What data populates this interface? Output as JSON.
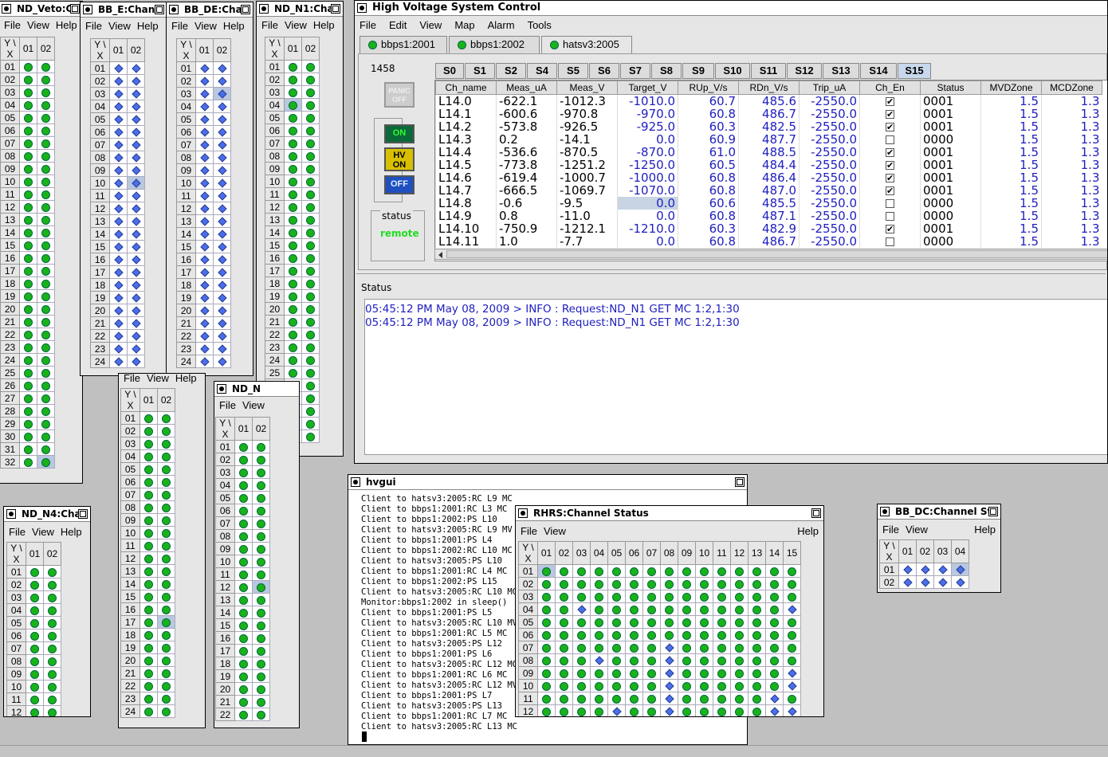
{
  "menus": {
    "file": "File",
    "view": "View",
    "help": "Help",
    "edit": "Edit",
    "map": "Map",
    "alarm": "Alarm",
    "tools": "Tools"
  },
  "grid_header": "Y \\ X",
  "windows": {
    "nd_veto": {
      "title": "ND_Veto:Cl"
    },
    "bb_e": {
      "title": "BB_E:Chan"
    },
    "bb_de": {
      "title": "BB_DE:Cha"
    },
    "nd_n1": {
      "title": "ND_N1:Cha"
    },
    "nd_n4": {
      "title": "ND_N4:Cha"
    },
    "nd_n": {
      "title": "ND_N"
    },
    "bb_dc": {
      "title": "BB_DC:Channel St"
    },
    "hvgui": {
      "title": "hvgui"
    },
    "rhrs": {
      "title": "RHRS:Channel Status"
    },
    "hv": {
      "title": "High Voltage System Control"
    }
  },
  "hv": {
    "tabs": [
      "bbps1:2001",
      "bbps1:2002",
      "hatsv3:2005"
    ],
    "active_tab": "hatsv3:2005",
    "panel_id": "1458",
    "panic_label": "PANIC OFF",
    "on_label": "ON",
    "hv_on_label": "HV ON",
    "off_label": "OFF",
    "status_label": "status",
    "status_value": "remote",
    "subtabs": [
      "S0",
      "S1",
      "S2",
      "S4",
      "S5",
      "S6",
      "S7",
      "S8",
      "S9",
      "S10",
      "S11",
      "S12",
      "S13",
      "S14",
      "S15"
    ],
    "active_subtab": "S15",
    "columns": [
      "Ch_name",
      "Meas_uA",
      "Meas_V",
      "Target_V",
      "RUp_V/s",
      "RDn_V/s",
      "Trip_uA",
      "Ch_En",
      "Status",
      "MVDZone",
      "MCDZone"
    ],
    "rows": [
      [
        "L14.0",
        "-622.1",
        "-1012.3",
        "-1010.0",
        "60.7",
        "485.6",
        "-2550.0",
        true,
        "0001",
        "1.5",
        "1.3"
      ],
      [
        "L14.1",
        "-600.6",
        "-970.8",
        "-970.0",
        "60.8",
        "486.7",
        "-2550.0",
        true,
        "0001",
        "1.5",
        "1.3"
      ],
      [
        "L14.2",
        "-573.8",
        "-926.5",
        "-925.0",
        "60.3",
        "482.5",
        "-2550.0",
        true,
        "0001",
        "1.5",
        "1.3"
      ],
      [
        "L14.3",
        "0.2",
        "-14.1",
        "0.0",
        "60.9",
        "487.7",
        "-2550.0",
        false,
        "0000",
        "1.5",
        "1.3"
      ],
      [
        "L14.4",
        "-536.6",
        "-870.5",
        "-870.0",
        "61.0",
        "488.5",
        "-2550.0",
        true,
        "0001",
        "1.5",
        "1.3"
      ],
      [
        "L14.5",
        "-773.8",
        "-1251.2",
        "-1250.0",
        "60.5",
        "484.4",
        "-2550.0",
        true,
        "0001",
        "1.5",
        "1.3"
      ],
      [
        "L14.6",
        "-619.4",
        "-1000.7",
        "-1000.0",
        "60.8",
        "486.4",
        "-2550.0",
        true,
        "0001",
        "1.5",
        "1.3"
      ],
      [
        "L14.7",
        "-666.5",
        "-1069.7",
        "-1070.0",
        "60.8",
        "487.0",
        "-2550.0",
        true,
        "0001",
        "1.5",
        "1.3"
      ],
      [
        "L14.8",
        "-0.6",
        "-9.5",
        "0.0",
        "60.6",
        "485.5",
        "-2550.0",
        false,
        "0000",
        "1.5",
        "1.3"
      ],
      [
        "L14.9",
        "0.8",
        "-11.0",
        "0.0",
        "60.8",
        "487.1",
        "-2550.0",
        false,
        "0000",
        "1.5",
        "1.3"
      ],
      [
        "L14.10",
        "-750.9",
        "-1212.1",
        "-1210.0",
        "60.3",
        "482.9",
        "-2550.0",
        true,
        "0001",
        "1.5",
        "1.3"
      ],
      [
        "L14.11",
        "1.0",
        "-7.7",
        "0.0",
        "60.8",
        "486.7",
        "-2550.0",
        false,
        "0000",
        "1.5",
        "1.3"
      ]
    ],
    "status_title": "Status",
    "log": [
      "05:45:12 PM May 08, 2009 > INFO : Request:ND_N1 GET MC 1:2,1:30",
      "05:45:12 PM May 08, 2009 > INFO : Request:ND_N1 GET MC 1:2,1:30"
    ]
  },
  "hvgui_log": [
    "Client to hatsv3:2005:RC L9 MC",
    "Client to bbps1:2001:RC L3 MC",
    "Client to bbps1:2002:PS L10",
    "Client to hatsv3:2005:RC L9 MV",
    "Client to bbps1:2001:PS L4",
    "Client to bbps1:2002:RC L10 MC",
    "Client to hatsv3:2005:PS L10",
    "Client to bbps1:2001:RC L4 MC",
    "Client to bbps1:2002:PS L15",
    "Client to hatsv3:2005:RC L10 MC",
    "Monitor:bbps1:2002 in sleep()",
    "Client to bbps1:2001:PS L5",
    "Client to hatsv3:2005:RC L10 MV",
    "Client to bbps1:2001:RC L5 MC",
    "Client to hatsv3:2005:PS L12",
    "Client to bbps1:2001:PS L6",
    "Client to hatsv3:2005:RC L12 MC",
    "Client to bbps1:2001:RC L6 MC",
    "Client to hatsv3:2005:RC L12 MV",
    "Client to bbps1:2001:PS L7",
    "Client to hatsv3:2005:PS L13",
    "Client to bbps1:2001:RC L7 MC",
    "Client to hatsv3:2005:RC L13 MC"
  ],
  "colors": {
    "led_green": "#19b319",
    "diamond_blue": "#4a6fe8",
    "remote_green": "#22dd22",
    "log_blue": "#2020c0"
  }
}
